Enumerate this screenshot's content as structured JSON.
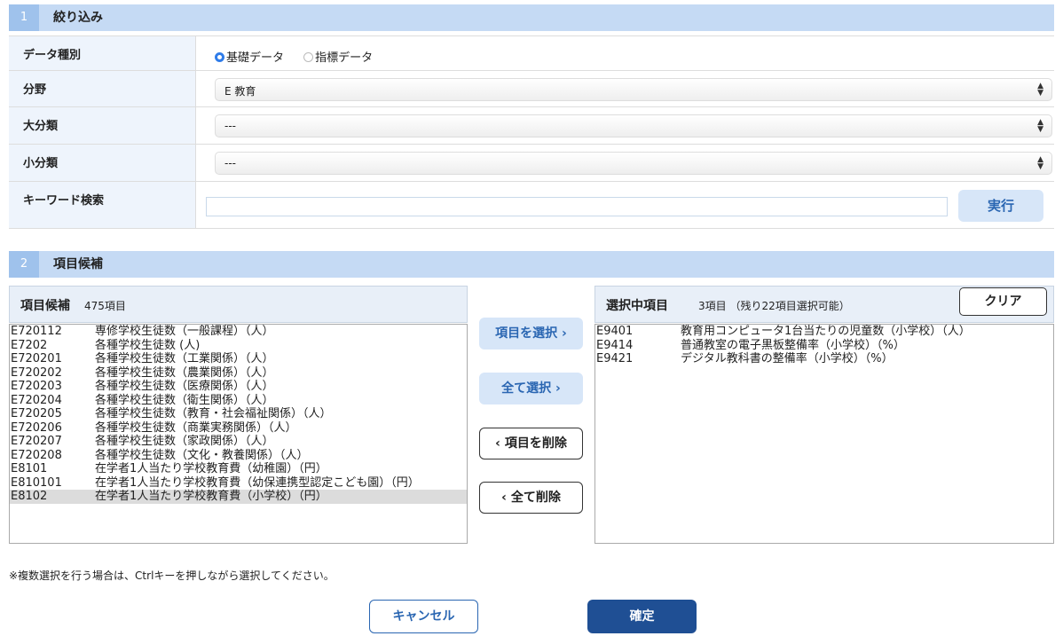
{
  "filter_section": {
    "number": "1",
    "title": "絞り込み",
    "data_type": {
      "label": "データ種別",
      "options": [
        {
          "label": "基礎データ",
          "selected": true
        },
        {
          "label": "指標データ",
          "selected": false
        }
      ]
    },
    "field": {
      "label": "分野",
      "value": "E 教育"
    },
    "major_category": {
      "label": "大分類",
      "value": "---"
    },
    "minor_category": {
      "label": "小分類",
      "value": "---"
    },
    "keyword": {
      "label": "キーワード検索",
      "value": "",
      "button": "実行"
    }
  },
  "candidate_section": {
    "number": "2",
    "title": "項目候補",
    "candidates": {
      "title": "項目候補",
      "count": "475項目",
      "items": [
        {
          "code": "E720112",
          "name": "専修学校生徒数（一般課程）（人）",
          "selected": false
        },
        {
          "code": "E7202",
          "name": "各種学校生徒数 (人)",
          "selected": false
        },
        {
          "code": "E720201",
          "name": "各種学校生徒数（工業関係）（人）",
          "selected": false
        },
        {
          "code": "E720202",
          "name": "各種学校生徒数（農業関係）（人）",
          "selected": false
        },
        {
          "code": "E720203",
          "name": "各種学校生徒数（医療関係）（人）",
          "selected": false
        },
        {
          "code": "E720204",
          "name": "各種学校生徒数（衛生関係）（人）",
          "selected": false
        },
        {
          "code": "E720205",
          "name": "各種学校生徒数（教育・社会福祉関係）（人）",
          "selected": false
        },
        {
          "code": "E720206",
          "name": "各種学校生徒数（商業実務関係）（人）",
          "selected": false
        },
        {
          "code": "E720207",
          "name": "各種学校生徒数（家政関係）（人）",
          "selected": false
        },
        {
          "code": "E720208",
          "name": "各種学校生徒数（文化・教養関係）（人）",
          "selected": false
        },
        {
          "code": "E8101",
          "name": "在学者1人当たり学校教育費（幼稚園）（円）",
          "selected": false
        },
        {
          "code": "E810101",
          "name": "在学者1人当たり学校教育費（幼保連携型認定こども園）（円）",
          "selected": false
        },
        {
          "code": "E8102",
          "name": "在学者1人当たり学校教育費（小学校）（円）",
          "selected": true
        }
      ]
    },
    "buttons": {
      "select_item": "項目を選択 ›",
      "select_all": "全て選択 ›",
      "delete_item": "‹ 項目を削除",
      "delete_all": "‹ 全て削除"
    },
    "selected": {
      "title": "選択中項目",
      "count": "3項目 （残り22項目選択可能）",
      "clear": "クリア",
      "items": [
        {
          "code": "E9401",
          "name": "教育用コンピュータ1台当たりの児童数（小学校）（人）"
        },
        {
          "code": "E9414",
          "name": "普通教室の電子黒板整備率（小学校）（%）"
        },
        {
          "code": "E9421",
          "name": "デジタル教科書の整備率（小学校）（%）"
        }
      ]
    }
  },
  "note": "※複数選択を行う場合は、Ctrlキーを押しながら選択してください。",
  "footer": {
    "cancel": "キャンセル",
    "confirm": "確定"
  }
}
